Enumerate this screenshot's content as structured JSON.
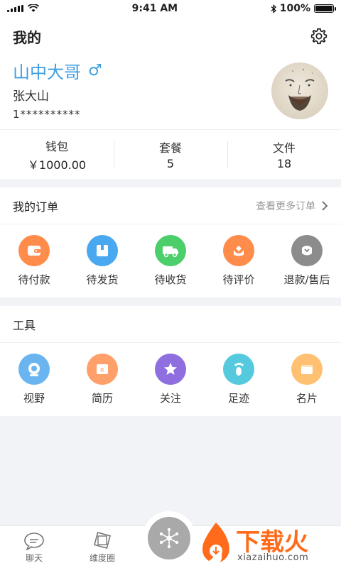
{
  "status_bar": {
    "time": "9:41 AM",
    "battery": "100%",
    "battery_level": 1.0
  },
  "header": {
    "title": "我的"
  },
  "profile": {
    "nickname": "山中大哥",
    "gender_symbol": "♂",
    "real_name": "张大山",
    "phone": "1**********"
  },
  "stats": [
    {
      "label": "钱包",
      "value": "￥1000.00"
    },
    {
      "label": "套餐",
      "value": "5"
    },
    {
      "label": "文件",
      "value": "18"
    }
  ],
  "orders": {
    "title": "我的订单",
    "more_label": "查看更多订单",
    "items": [
      {
        "label": "待付款",
        "icon": "wallet-icon",
        "color": "#ff8c4a"
      },
      {
        "label": "待发货",
        "icon": "box-icon",
        "color": "#4aa8f0"
      },
      {
        "label": "待收货",
        "icon": "truck-icon",
        "color": "#4ccf6a"
      },
      {
        "label": "待评价",
        "icon": "flower-icon",
        "color": "#ff8c4a"
      },
      {
        "label": "退款/售后",
        "icon": "service-icon",
        "color": "#8c8c8c"
      }
    ]
  },
  "tools": {
    "title": "工具",
    "items": [
      {
        "label": "视野",
        "icon": "camera-icon",
        "color": "#6ab5f0"
      },
      {
        "label": "简历",
        "icon": "resume-icon",
        "color": "#ffa06a"
      },
      {
        "label": "关注",
        "icon": "star-icon",
        "color": "#8f6ee0"
      },
      {
        "label": "足迹",
        "icon": "footprint-icon",
        "color": "#55c9dd"
      },
      {
        "label": "名片",
        "icon": "card-icon",
        "color": "#ffc072"
      }
    ]
  },
  "tabbar": {
    "tabs": [
      {
        "label": "聊天",
        "icon": "chat-icon"
      },
      {
        "label": "维度圈",
        "icon": "circle-icon"
      }
    ]
  },
  "watermark": {
    "text": "下载火",
    "sub": "xiazaihuo.com"
  }
}
